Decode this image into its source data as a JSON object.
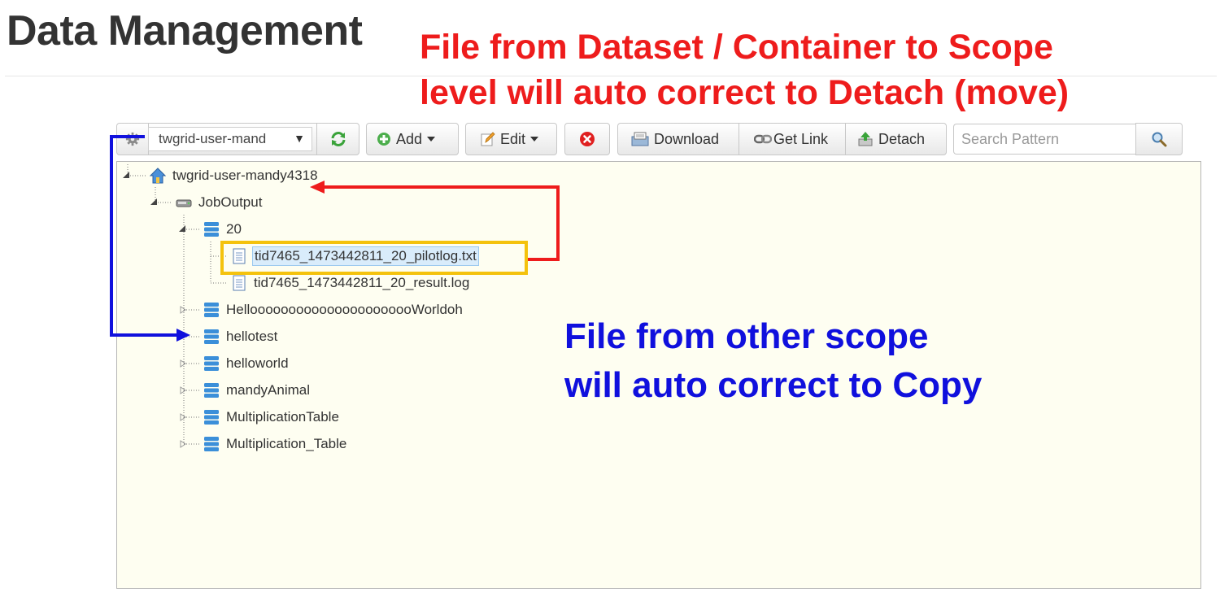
{
  "page": {
    "title": "Data Management"
  },
  "annotations": {
    "detach_note": {
      "line1": "File from Dataset / Container to Scope",
      "line2": "level will auto correct to Detach (move)"
    },
    "copy_note": {
      "line1": "File from other scope",
      "line2": "will auto correct to Copy"
    }
  },
  "toolbar": {
    "scope_select": {
      "value": "twgrid-user-mand"
    },
    "add_label": "Add",
    "edit_label": "Edit",
    "download_label": "Download",
    "get_link_label": "Get Link",
    "detach_label": "Detach",
    "search": {
      "placeholder": "Search Pattern"
    }
  },
  "tree": {
    "root": "twgrid-user-mandy4318",
    "container": "JobOutput",
    "dataset_20": "20",
    "file_pilotlog": "tid7465_1473442811_20_pilotlog.txt",
    "file_result": "tid7465_1473442811_20_result.log",
    "datasets": [
      "HelloooooooooooooooooooooWorldoh",
      "hellotest",
      "helloworld",
      "mandyAnimal",
      "MultiplicationTable",
      "Multiplication_Table"
    ]
  },
  "colors": {
    "annotation_red": "#ee1c1c",
    "annotation_blue": "#1010dd",
    "selection_frame": "#f4c20d",
    "panel_bg": "#fefef1"
  },
  "icons": [
    "gear-icon",
    "refresh-icon",
    "plus-circle-icon",
    "pencil-icon",
    "delete-icon",
    "download-icon",
    "link-icon",
    "detach-icon",
    "search-icon",
    "home-icon",
    "drive-icon",
    "database-icon",
    "file-icon"
  ]
}
